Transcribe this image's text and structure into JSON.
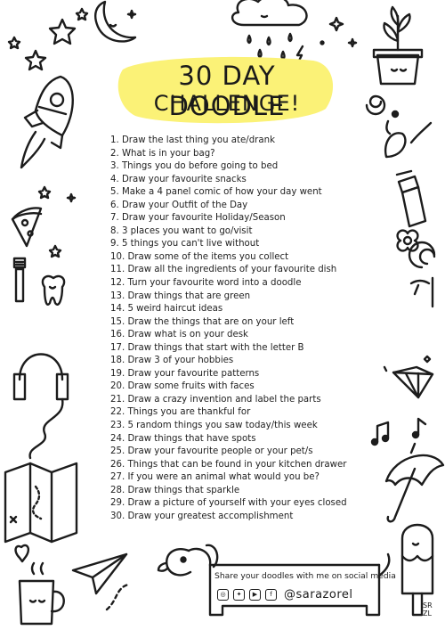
{
  "title": {
    "line1": "30 DAY DOODLE",
    "line2": "CHALLENGE!"
  },
  "colors": {
    "highlight": "#fbf277",
    "ink": "#1c1c1c"
  },
  "prompts": [
    "1. Draw the last thing you ate/drank",
    "2. What is in your bag?",
    "3. Things you do before going to bed",
    "4. Draw your favourite snacks",
    "5. Make a 4 panel comic of how your day went",
    "6. Draw your Outfit of the Day",
    "7. Draw your favourite Holiday/Season",
    "8. 3 places you want to go/visit",
    "9. 5 things you can't live without",
    "10. Draw some of the items you collect",
    "11. Draw all the ingredients of your favourite dish",
    "12. Turn your favourite word into a doodle",
    "13. Draw things that are green",
    "14. 5 weird haircut ideas",
    "15. Draw the things that are on your left",
    "16. Draw what is on your desk",
    "17. Draw things that start with the letter B",
    "18. Draw 3 of your hobbies",
    "19. Draw your favourite patterns",
    "20. Draw some fruits with faces",
    "21. Draw a crazy invention and label the parts",
    "22. Things you are thankful for",
    "23. 5 random things you saw today/this week",
    "24. Draw things that have spots",
    "25. Draw your favourite people or your pet/s",
    "26. Things that can be found in your kitchen drawer",
    "27. If you were an animal what would you be?",
    "28. Draw things that sparkle",
    "29. Draw a picture of yourself with your eyes closed",
    "30. Draw your greatest accomplishment"
  ],
  "footer": {
    "share_text": "Share your doodles with me on social media",
    "handle": "@sarazorel",
    "social_icons": [
      "instagram-icon",
      "twitter-icon",
      "youtube-icon",
      "facebook-icon"
    ],
    "signature": "SR\nZL"
  }
}
